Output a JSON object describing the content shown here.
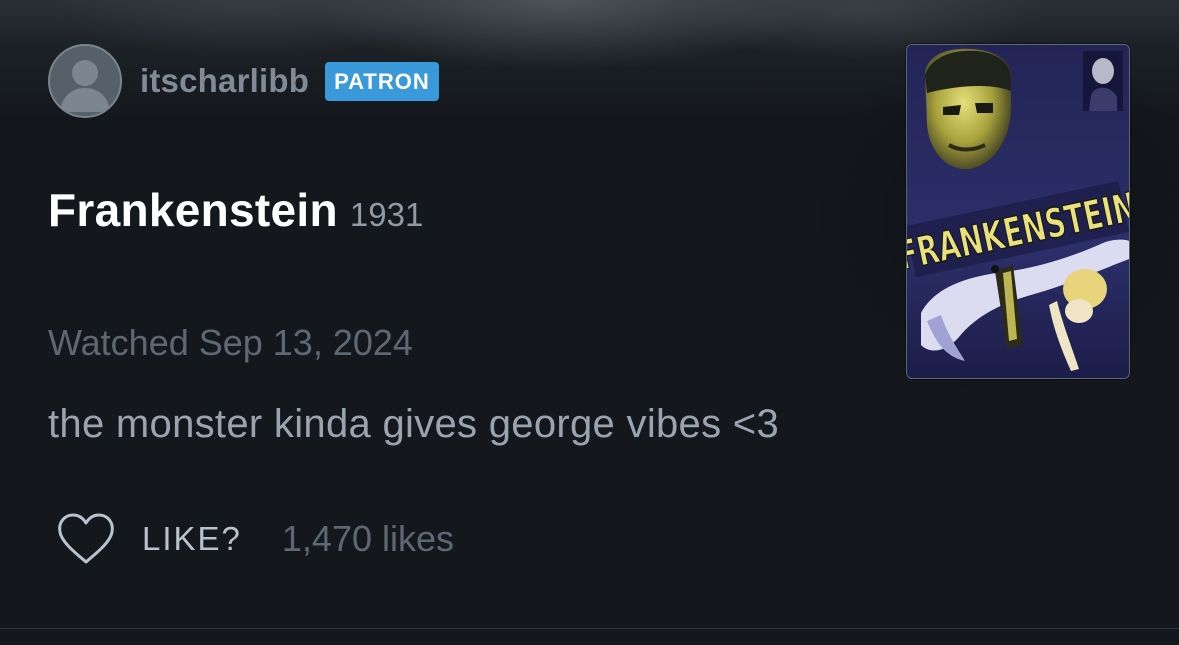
{
  "review": {
    "author": {
      "username": "itscharlibb",
      "badge": "PATRON",
      "avatar_icon": "default-user-avatar"
    },
    "film": {
      "title": "Frankenstein",
      "year": "1931",
      "poster_title_text": "FRANKENSTEIN"
    },
    "watched_label": "Watched Sep 13, 2024",
    "text": "the monster kinda gives george vibes <3",
    "like": {
      "label": "LIKE?",
      "count_text": "1,470 likes",
      "icon": "heart-outline-icon"
    }
  },
  "colors": {
    "background": "#14181c",
    "badge": "#3a9ad9",
    "title": "#ffffff",
    "muted": "#5d6873",
    "body_text": "#98a4b0"
  }
}
